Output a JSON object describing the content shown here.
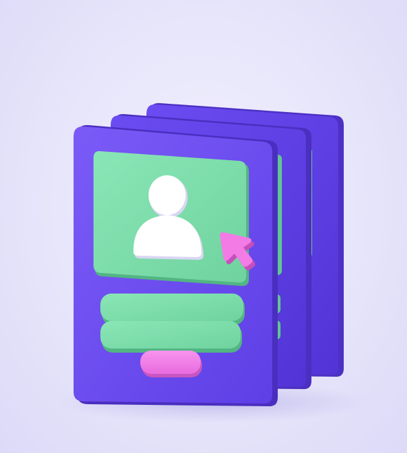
{
  "scene": {
    "subject": "profile-card-stack-3d-illustration",
    "card_count": 3,
    "colors": {
      "background": "#e9e7fb",
      "card_front": "#6a4cf0",
      "card_edge": "#5136c9",
      "photo_panel": "#78dca6",
      "photo_panel_edge": "#55b988",
      "avatar": "#ffffff",
      "text_bars": "#7fe0ae",
      "button": "#f27be6",
      "cursor": "#f06fe0"
    },
    "icons": [
      "user-avatar-icon",
      "pointer-cursor-icon"
    ]
  }
}
